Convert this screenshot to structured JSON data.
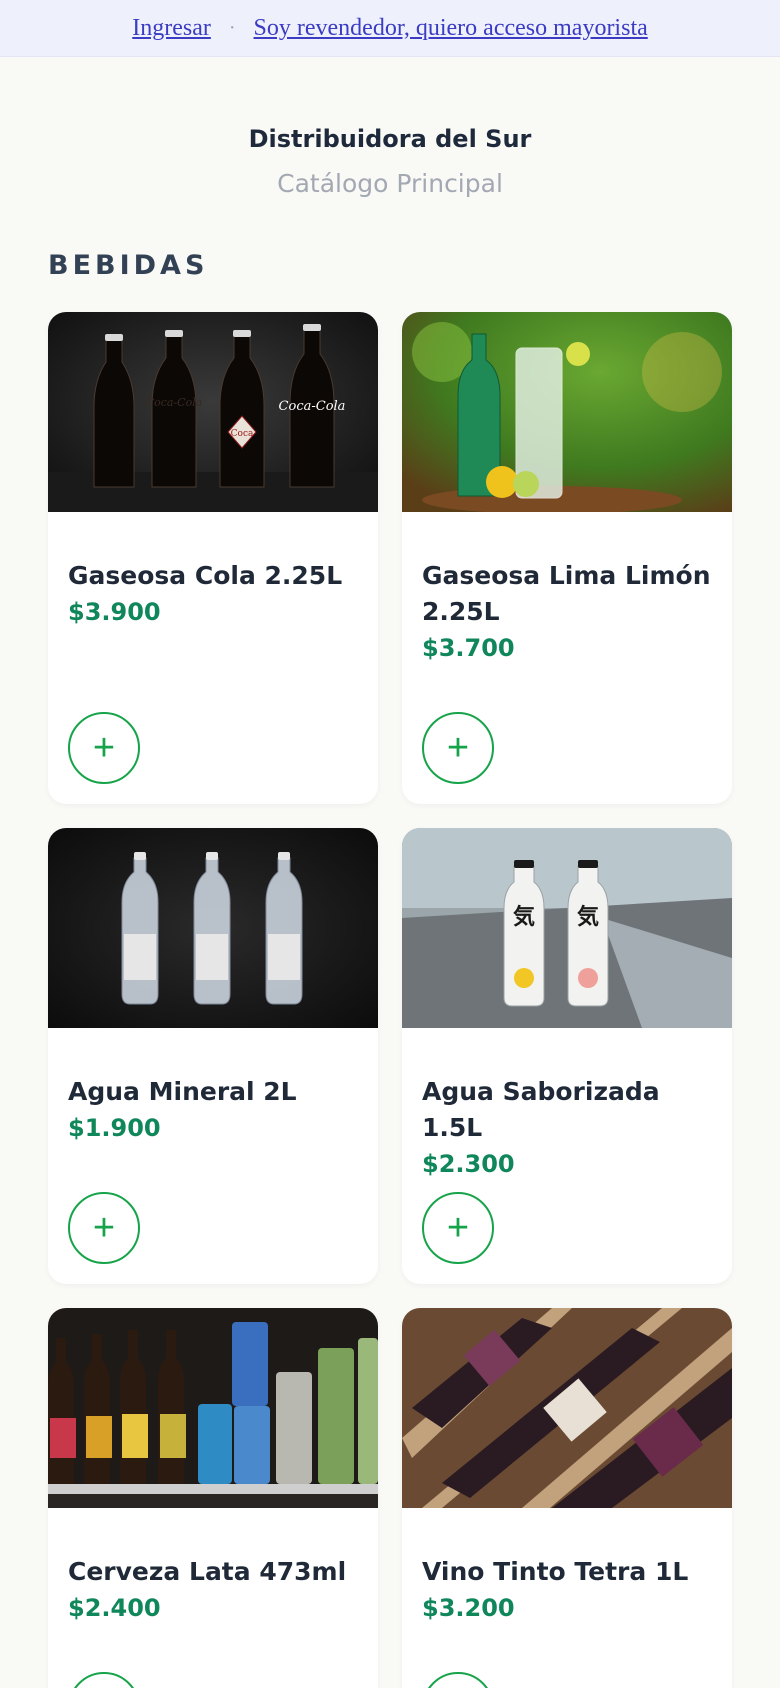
{
  "topbar": {
    "login_label": "Ingresar",
    "separator": "·",
    "wholesale_label": "Soy revendedor, quiero acceso mayorista"
  },
  "header": {
    "store_name": "Distribuidora del Sur",
    "catalog_name": "Catálogo Principal"
  },
  "section": {
    "title": "BEBIDAS"
  },
  "products": [
    {
      "name": "Gaseosa Cola 2.25L",
      "price": "$3.900",
      "image": "cola-bottles-photo"
    },
    {
      "name": "Gaseosa Lima Limón 2.25L",
      "price": "$3.700",
      "image": "lemon-soda-glass-photo"
    },
    {
      "name": "Agua Mineral 2L",
      "price": "$1.900",
      "image": "water-bottles-photo"
    },
    {
      "name": "Agua Saborizada 1.5L",
      "price": "$2.300",
      "image": "flavored-water-photo"
    },
    {
      "name": "Cerveza Lata 473ml",
      "price": "$2.400",
      "image": "beer-cans-fridge-photo"
    },
    {
      "name": "Vino Tinto Tetra 1L",
      "price": "$3.200",
      "image": "wine-bottles-box-photo"
    }
  ],
  "add_button": {
    "symbol": "+"
  },
  "colors": {
    "accent_green": "#16a34a",
    "price_green": "#10875a",
    "link_blue": "#3b3bc4",
    "topbar_bg": "#eef1fc"
  }
}
